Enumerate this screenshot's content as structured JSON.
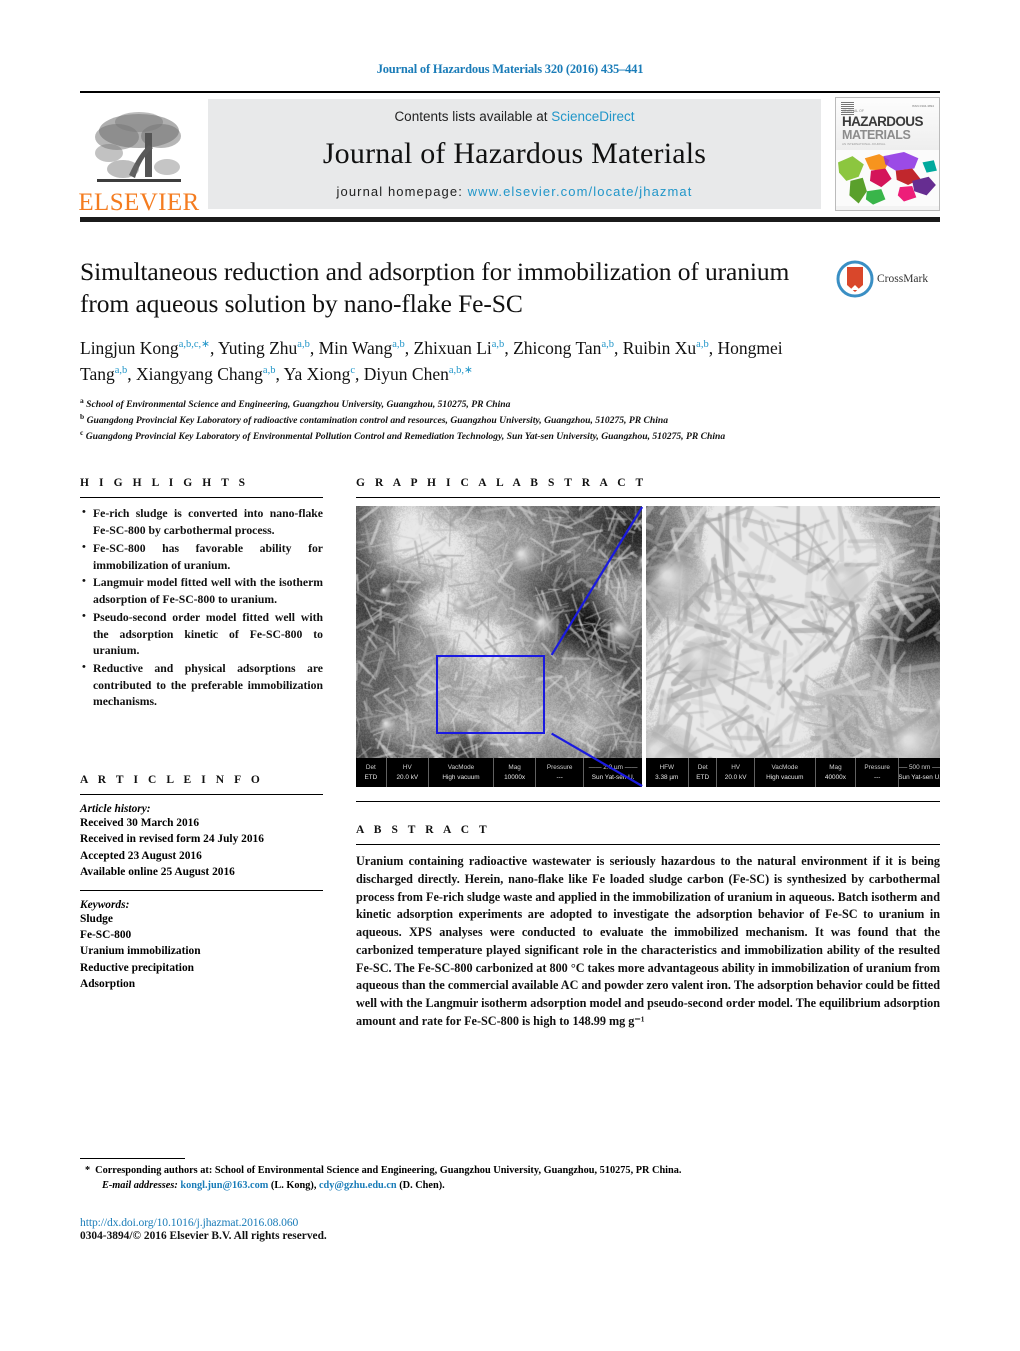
{
  "running_head": "Journal of Hazardous Materials 320 (2016) 435–441",
  "masthead": {
    "contents_prefix": "Contents lists available at ",
    "sciencedirect": "ScienceDirect",
    "journal_name": "Journal of Hazardous Materials",
    "homepage_prefix": "journal homepage: ",
    "homepage_url": "www.elsevier.com/locate/jhazmat",
    "publisher": "ELSEVIER",
    "cover": {
      "title_line1": "HAZARDOUS",
      "title_line2": "MATERIALS",
      "kicker": "JOURNAL OF",
      "subtitle": "AN INTERNATIONAL JOURNAL FOR HAZARDOUS MATERIALS"
    },
    "link_color": "#2196c9"
  },
  "article": {
    "title": "Simultaneous reduction and adsorption for immobilization of uranium from aqueous solution by nano-flake Fe-SC",
    "crossmark_label": "CrossMark",
    "authors": [
      {
        "name": "Lingjun Kong",
        "sup": "a,b,c,∗"
      },
      {
        "name": "Yuting Zhu",
        "sup": "a,b"
      },
      {
        "name": "Min Wang",
        "sup": "a,b"
      },
      {
        "name": "Zhixuan Li",
        "sup": "a,b"
      },
      {
        "name": "Zhicong Tan",
        "sup": "a,b"
      },
      {
        "name": "Ruibin Xu",
        "sup": "a,b"
      },
      {
        "name": "Hongmei Tang",
        "sup": "a,b"
      },
      {
        "name": "Xiangyang Chang",
        "sup": "a,b"
      },
      {
        "name": "Ya Xiong",
        "sup": "c"
      },
      {
        "name": "Diyun Chen",
        "sup": "a,b,∗"
      }
    ],
    "affiliations": [
      {
        "mark": "a",
        "text": "School of Environmental Science and Engineering, Guangzhou University, Guangzhou, 510275, PR China"
      },
      {
        "mark": "b",
        "text": "Guangdong Provincial Key Laboratory of radioactive contamination control and resources, Guangzhou University, Guangzhou, 510275, PR China"
      },
      {
        "mark": "c",
        "text": "Guangdong Provincial Key Laboratory of Environmental Pollution Control and Remediation Technology, Sun Yat-sen University, Guangzhou, 510275, PR China"
      }
    ]
  },
  "highlights": {
    "heading": "H I G H L I G H T S",
    "items": [
      "Fe-rich sludge is converted into nano-flake Fe-SC-800 by carbothermal process.",
      "Fe-SC-800 has favorable ability for immobilization of uranium.",
      "Langmuir model fitted well with the isotherm adsorption of Fe-SC-800 to uranium.",
      "Pseudo-second order model fitted well with the adsorption kinetic of Fe-SC-800 to uranium.",
      "Reductive and physical adsorptions are contributed to the preferable immobilization mechanisms."
    ]
  },
  "article_info": {
    "heading": "A R T I C L E     I N F O",
    "history_label": "Article history:",
    "history": [
      "Received 30 March 2016",
      "Received in revised form 24 July 2016",
      "Accepted 23 August 2016",
      "Available online 25 August 2016"
    ],
    "keywords_label": "Keywords:",
    "keywords": [
      "Sludge",
      "Fe-SC-800",
      "Uranium immobilization",
      "Reductive precipitation",
      "Adsorption"
    ]
  },
  "graphical_abstract": {
    "heading": "G R A P H I C A L   A B S T R A C T",
    "left_panel": {
      "columns": [
        "Det",
        "HV",
        "VacMode",
        "Mag",
        "Pressure"
      ],
      "values": [
        "ETD",
        "20.0 kV",
        "High vacuum",
        "10000x",
        "---"
      ],
      "scale_bar": "2.0 µm",
      "institution": "Sun Yat-sen U."
    },
    "right_panel": {
      "columns": [
        "HFW",
        "Det",
        "HV",
        "VacMode",
        "Mag",
        "Pressure"
      ],
      "values": [
        "3.38 µm",
        "ETD",
        "20.0 kV",
        "High vacuum",
        "40000x",
        "---"
      ],
      "scale_bar": "500 nm",
      "institution": "Sun Yat-sen U."
    },
    "roi_color": "#1a1ae0"
  },
  "abstract": {
    "heading": "A B S T R A C T",
    "text": "Uranium containing radioactive wastewater is seriously hazardous to the natural environment if it is being discharged directly. Herein, nano-flake like Fe loaded sludge carbon (Fe-SC) is synthesized by carbothermal process from Fe-rich sludge waste and applied in the immobilization of uranium in aqueous. Batch isotherm and kinetic adsorption experiments are adopted to investigate the adsorption behavior of Fe-SC to uranium in aqueous. XPS analyses were conducted to evaluate the immobilized mechanism. It was found that the carbonized temperature played significant role in the characteristics and immobilization ability of the resulted Fe-SC. The Fe-SC-800 carbonized at 800 °C takes more advantageous ability in immobilization of uranium from aqueous than the commercial available AC and powder zero valent iron. The adsorption behavior could be fitted well with the Langmuir isotherm adsorption model and pseudo-second order model. The equilibrium adsorption amount and rate for Fe-SC-800 is high to 148.99 mg g⁻¹"
  },
  "footnotes": {
    "corresponding_star": "*",
    "corresponding_text": "Corresponding authors at: School of Environmental Science and Engineering, Guangzhou University, Guangzhou, 510275, PR China.",
    "email_label": "E-mail addresses:",
    "email1": "kongl.jun@163.com",
    "email1_owner": "(L. Kong),",
    "email2": "cdy@gzhu.edu.cn",
    "email2_owner": "(D. Chen).",
    "doi": "http://dx.doi.org/10.1016/j.jhazmat.2016.08.060",
    "copyright": "0304-3894/© 2016 Elsevier B.V. All rights reserved."
  }
}
